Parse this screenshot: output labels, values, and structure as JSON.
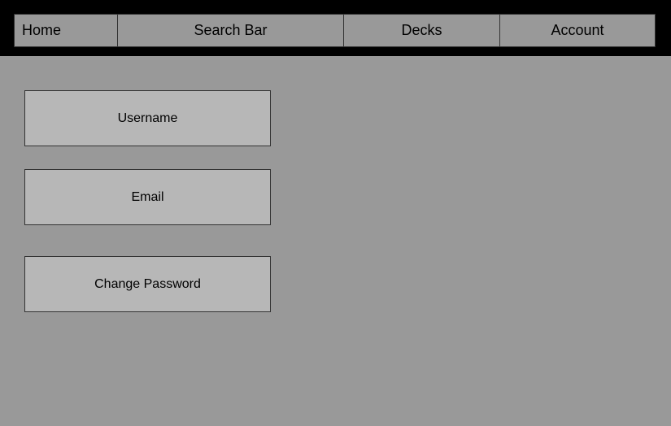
{
  "nav": {
    "home_label": "Home",
    "search_label": "Search Bar",
    "decks_label": "Decks",
    "account_label": "Account"
  },
  "account_page": {
    "username_label": "Username",
    "email_label": "Email",
    "change_password_label": "Change Password"
  },
  "colors": {
    "background": "#999999",
    "navbar_background": "#000000",
    "field_background": "#b7b7b7",
    "border": "#333333"
  }
}
